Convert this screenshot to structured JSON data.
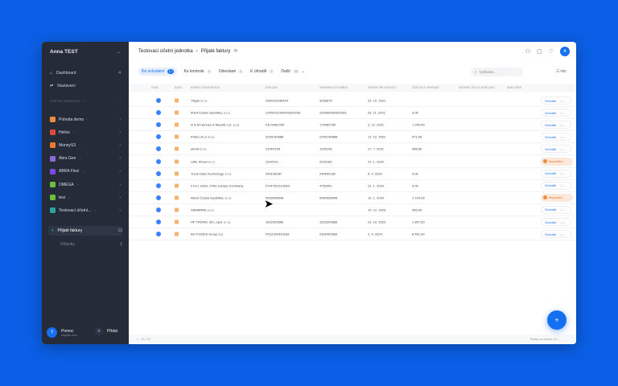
{
  "sidebar": {
    "user": "Anna TEST",
    "nav": [
      {
        "label": "Dashboard",
        "count": "4"
      },
      {
        "label": "Nastavení"
      }
    ],
    "section": "ÚČETNÍ JEDNOTKY",
    "units": [
      {
        "label": "Pohoda demo",
        "color": "#f08a3c"
      },
      {
        "label": "Helios",
        "color": "#e04a3c"
      },
      {
        "label": "MoneyS3",
        "color": "#f07a2c"
      },
      {
        "label": "Abra Gen",
        "color": "#8a6ad8"
      },
      {
        "label": "ABRA Flexi",
        "color": "#7b4ae8"
      },
      {
        "label": "OMEGA",
        "color": "#6bbf3a"
      },
      {
        "label": "test",
        "color": "#6bbf3a"
      },
      {
        "label": "Testovací účetní...",
        "color": "#2aa39a"
      }
    ],
    "subs": [
      {
        "label": "Přijaté faktury",
        "count": "13"
      },
      {
        "label": "Účtenky",
        "count": "1"
      }
    ],
    "help": {
      "title": "Pomoc",
      "subtitle": "Napište nám"
    },
    "add": "Přidat"
  },
  "header": {
    "unit": "Testovací účetní jednotka",
    "page": "Přijaté faktury",
    "avatar": "A"
  },
  "tabs": [
    {
      "label": "Ke schválení",
      "count": "12"
    },
    {
      "label": "Ke kontrole",
      "count": "0"
    },
    {
      "label": "Odeslané",
      "count": "6"
    },
    {
      "label": "K úhradě",
      "count": "0"
    },
    {
      "label": "Další",
      "count": "25"
    }
  ],
  "search": {
    "placeholder": "Vyhledat..."
  },
  "filter": "Filtr",
  "columns": [
    "STAV",
    "DATA",
    "NÁZEV DODAVATELE",
    "DOKLAD",
    "VARIABILNÍ SYMBOL",
    "DATUM SPLATNOSTI",
    "ČÁSTKA K ÚHRADĚ",
    "INTERNÍ ČÍSLO DOKLADU",
    "NAPOJENÍ"
  ],
  "rows": [
    {
      "name": "Yligan s.r.o.",
      "doc": "2W2021150424",
      "vs": "3256675",
      "date": "29. 10. 2021",
      "amount": "",
      "action": "Schválit"
    },
    {
      "name": "IKEA Česká republika, s.r.o.",
      "doc": "CZINV22000000320293",
      "vs": "220000000320293",
      "date": "25. 11. 2021",
      "amount": "0,00",
      "action": "Schválit"
    },
    {
      "name": "H & M Hennes & Mauritz CZ, s.r.o.",
      "doc": "KS79462780",
      "vs": "179462780",
      "date": "2. 12. 2021",
      "amount": "1 240,00",
      "action": "Schválit"
    },
    {
      "name": "PUELLA.cz s.r.o.",
      "doc": "2200140688",
      "vs": "2200140688",
      "date": "12. 12. 2022",
      "amount": "571,99",
      "action": "Schválit"
    },
    {
      "name": "ekmi6 s.r.o.",
      "doc": "210F0109",
      "vs": "1240146",
      "date": "27. 7. 2021",
      "amount": "488,50",
      "action": "Schválit"
    },
    {
      "name": "Little Shoes s.r.o.",
      "doc": "2202010",
      "vs": "2202182",
      "date": "31. 1. 2022",
      "amount": "",
      "action": "Nepodařilo..."
    },
    {
      "name": "Truck Data Technology, s.r.o.",
      "doc": "240106087",
      "vs": "240602182",
      "date": "9. 4. 2024",
      "amount": "0,00",
      "action": "Schválit"
    },
    {
      "name": "F.H.U. AXEL STAL Łukasz Kornikany",
      "doc": "FV/475/122/3401",
      "vs": "4752401",
      "date": "21. 1. 2024",
      "amount": "0,00",
      "action": "Schválit"
    },
    {
      "name": "Albert Česká republika, s.r.o.",
      "doc": "0000008548",
      "vs": "0000008548",
      "date": "19. 1. 2024",
      "amount": "1 724,03",
      "action": "Nepodařilo..."
    },
    {
      "name": "SAMARNE s.r.o.",
      "doc": "",
      "vs": "",
      "date": "10. 12. 2023",
      "amount": "955,00",
      "action": "Schválit"
    },
    {
      "name": "HP TRONIC Zlín, spol. s r.o.",
      "doc": "1622993566",
      "vs": "1622993566",
      "date": "23. 10. 2023",
      "amount": "1 807,00",
      "action": "Schválit"
    },
    {
      "name": "AG FOODS Group a.s.",
      "doc": "P012302493183",
      "vs": "2302400583",
      "date": "2. 4. 2024",
      "amount": "8 451,00",
      "action": "Schválit"
    }
  ],
  "footer": {
    "range": "1 - 12 z 12",
    "per_page_label": "Řádky na stránku",
    "per_page": "20"
  }
}
